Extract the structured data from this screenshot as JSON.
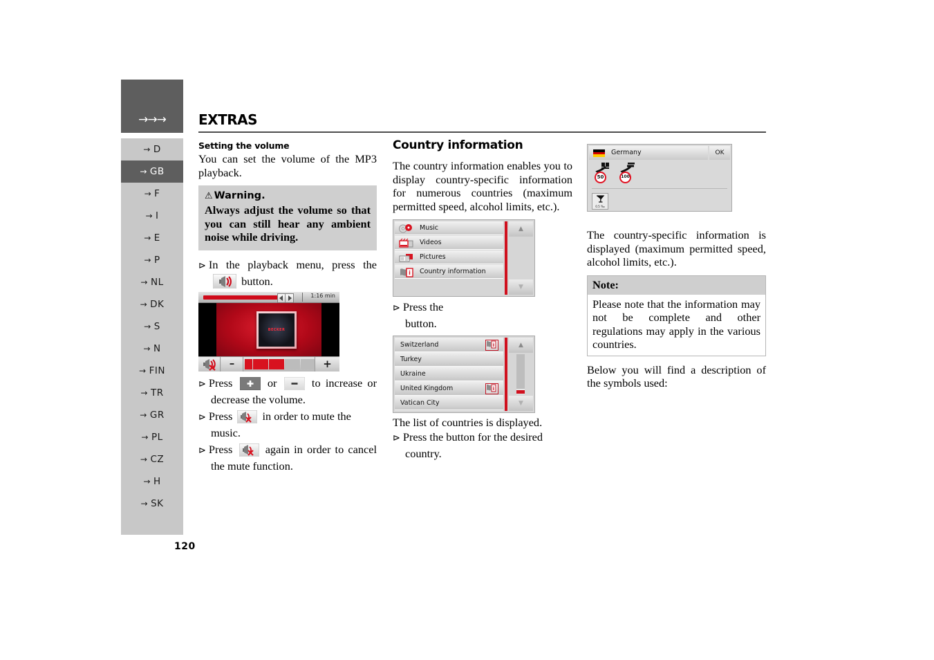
{
  "sidebar": {
    "arrows": "→→→",
    "items": [
      {
        "label": "D",
        "active": false
      },
      {
        "label": "GB",
        "active": true
      },
      {
        "label": "F",
        "active": false
      },
      {
        "label": "I",
        "active": false
      },
      {
        "label": "E",
        "active": false
      },
      {
        "label": "P",
        "active": false
      },
      {
        "label": "NL",
        "active": false
      },
      {
        "label": "DK",
        "active": false
      },
      {
        "label": "S",
        "active": false
      },
      {
        "label": "N",
        "active": false
      },
      {
        "label": "FIN",
        "active": false
      },
      {
        "label": "TR",
        "active": false
      },
      {
        "label": "GR",
        "active": false
      },
      {
        "label": "PL",
        "active": false
      },
      {
        "label": "CZ",
        "active": false
      },
      {
        "label": "H",
        "active": false
      },
      {
        "label": "SK",
        "active": false
      }
    ]
  },
  "header": {
    "chapter_title": "EXTRAS"
  },
  "page_number": "120",
  "column_left": {
    "sub_heading": "Setting the volume",
    "intro": "You can set the volume of the MP3 playback.",
    "warning": {
      "title": "Warning.",
      "triangle": "⚠",
      "text": "Always adjust the volume so that you can still hear any ambient noise while driving."
    },
    "step_playback_prefix": "In the playback menu, press the",
    "step_playback_suffix": "button.",
    "mp3_screen": {
      "time": "1:16 min",
      "cover_logo": "BECKER",
      "minus_label": "–",
      "plus_label": "+",
      "volume_on_segments": 5,
      "volume_off_segments": 4
    },
    "step_volume": {
      "prefix": "Press",
      "plus": "+",
      "middle": "or",
      "minus": "–",
      "suffix": "to increase or decrease the volume."
    },
    "step_mute": {
      "prefix": "Press",
      "suffix": "in order to mute the music."
    },
    "step_unmute": {
      "prefix": "Press",
      "suffix": "again in order to cancel the mute function."
    }
  },
  "column_middle": {
    "section_heading": "Country information",
    "intro": "The country information enables you to display country-specific information for numerous countries (maximum permitted speed, alcohol limits, etc.).",
    "menu_screen": {
      "rows": [
        {
          "label": "Music",
          "icon": "cd-icon"
        },
        {
          "label": "Videos",
          "icon": "video-icon"
        },
        {
          "label": "Pictures",
          "icon": "picture-icon"
        },
        {
          "label": "Country information",
          "icon": "country-info-icon"
        }
      ],
      "scroll_up": "▲",
      "scroll_down": "▼"
    },
    "step_press": {
      "prefix": "Press the",
      "suffix": "button."
    },
    "country_screen": {
      "rows": [
        {
          "label": "Switzerland",
          "has_flag": true
        },
        {
          "label": "Turkey",
          "has_flag": false
        },
        {
          "label": "Ukraine",
          "has_flag": false
        },
        {
          "label": "United Kingdom",
          "has_flag": true
        },
        {
          "label": "Vatican City",
          "has_flag": false
        }
      ],
      "scroll_up": "▲",
      "scroll_down": "▼"
    },
    "result_line": "The list of countries is displayed.",
    "step_select": "Press the button for the desired country."
  },
  "column_right": {
    "germany_screen": {
      "country": "Germany",
      "ok_label": "OK",
      "flag_colors": [
        "#000000",
        "#d40000",
        "#ffcc00"
      ],
      "signs": [
        {
          "icon": "city-speed-limit-icon",
          "value": "50"
        },
        {
          "icon": "highway-speed-limit-icon",
          "value": "100"
        }
      ],
      "alcohol_limit": "0.5 ‰"
    },
    "para_displayed": "The country-specific information is displayed (maximum permitted speed, alcohol limits, etc.).",
    "note": {
      "title": "Note:",
      "text": "Please note that the information may not be complete and other regulations may apply in the various countries."
    },
    "para_below": "Below you will find a description of the symbols used:"
  },
  "colors": {
    "sidebar_bg": "#c8c8c8",
    "sidebar_active": "#5e5e5e",
    "warning_bg": "#cfcfcf",
    "accent_red": "#cf0a1a",
    "rule": "#4d4d4d"
  }
}
